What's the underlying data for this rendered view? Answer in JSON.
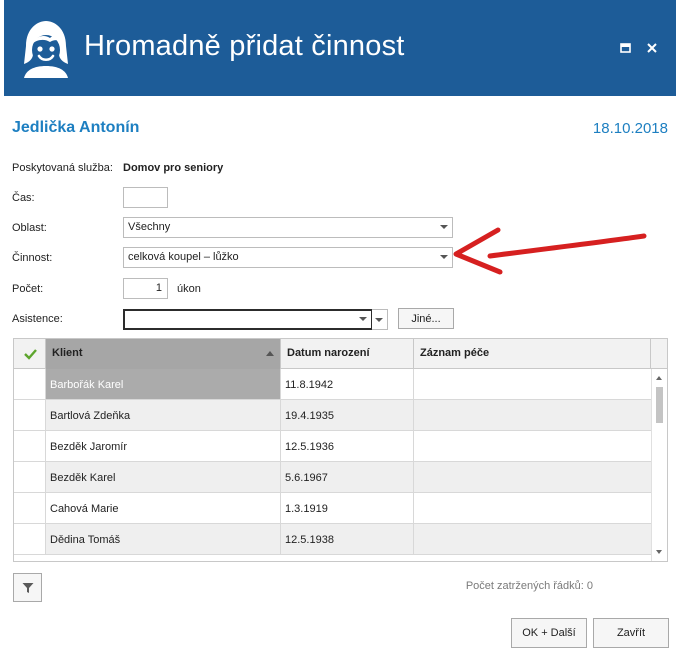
{
  "window": {
    "title": "Hromadně přidat činnost",
    "logo_icon": "smiling-face-logo",
    "restore_icon": "restore-window-icon",
    "close_icon": "close-icon",
    "titlebar_color": "#1d5c98"
  },
  "client": {
    "name": "Jedlička Antonín",
    "date": "18.10.2018",
    "accent_color": "#1d7fc1"
  },
  "form": {
    "service_label": "Poskytovaná služba:",
    "service_value": "Domov pro seniory",
    "time_label": "Čas:",
    "time_value": "",
    "area_label": "Oblast:",
    "area_value": "Všechny",
    "activity_label": "Činnost:",
    "activity_value": "celková koupel – lůžko",
    "count_label": "Počet:",
    "count_value": "1",
    "count_unit": "úkon",
    "assist_label": "Asistence:",
    "assist_value": "",
    "other_button": "Jiné..."
  },
  "grid": {
    "columns": [
      "Klient",
      "Datum narození",
      "Záznam péče"
    ],
    "sorted_column": "Klient",
    "sort_direction": "ascending",
    "rows": [
      {
        "client": "Barbořák Karel",
        "birth": "11.8.1942",
        "record": "",
        "selected": true
      },
      {
        "client": "Bartlová Zdeňka",
        "birth": "19.4.1935",
        "record": ""
      },
      {
        "client": "Bezděk Jaromír",
        "birth": "12.5.1936",
        "record": ""
      },
      {
        "client": "Bezděk Karel",
        "birth": "5.6.1967",
        "record": ""
      },
      {
        "client": "Cahová Marie",
        "birth": "1.3.1919",
        "record": ""
      },
      {
        "client": "Dědina Tomáš",
        "birth": "12.5.1938",
        "record": ""
      }
    ]
  },
  "footer": {
    "checked_rows_label": "Počet zatržených řádků: 0",
    "ok_next_button": "OK + Další",
    "close_button": "Zavřít",
    "filter_icon": "filter-icon"
  },
  "annotation": {
    "arrow_color": "#d62020",
    "points_to": "activity"
  }
}
